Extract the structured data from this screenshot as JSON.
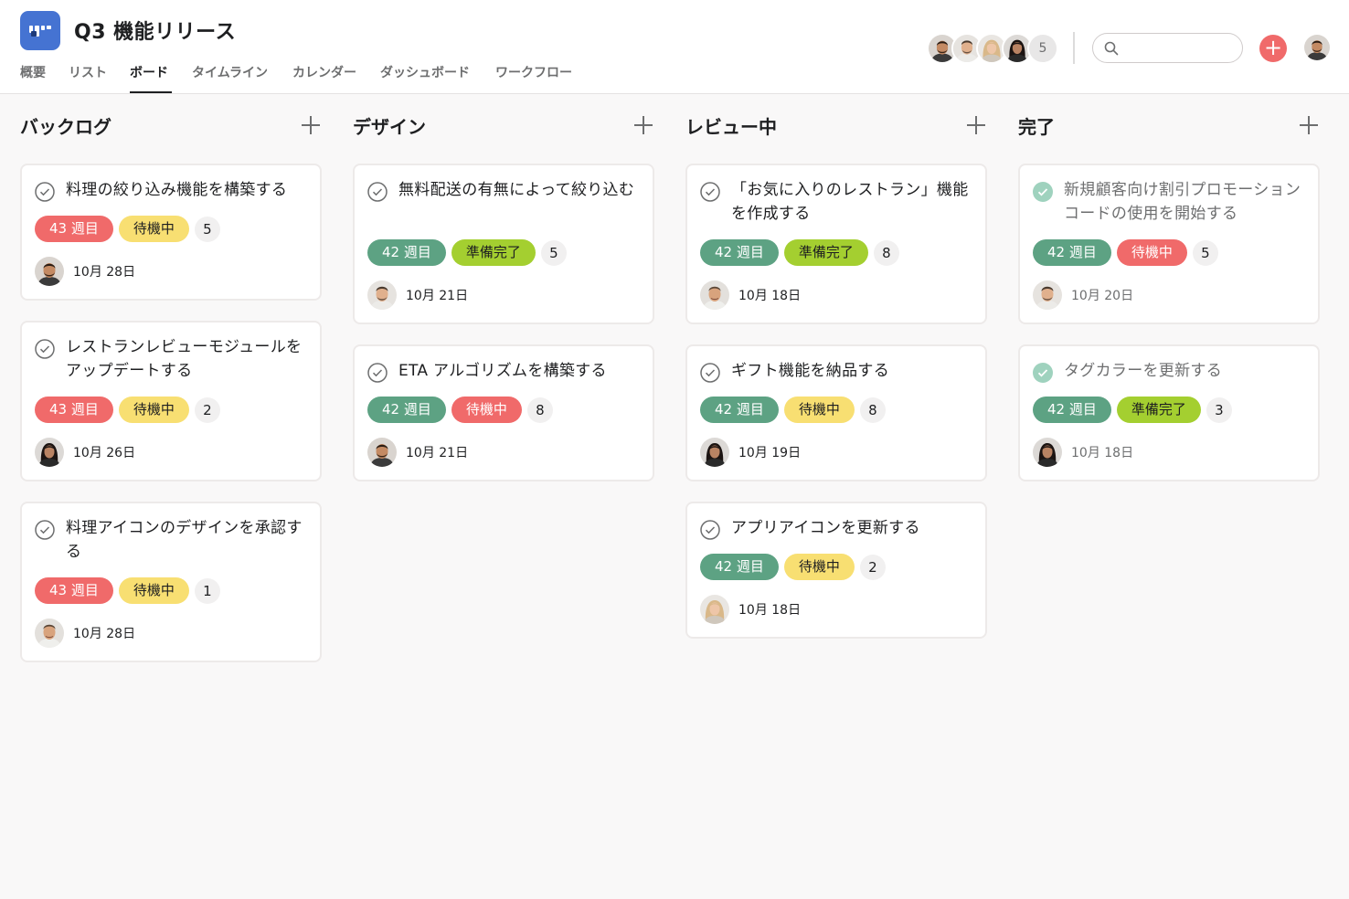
{
  "project": {
    "title": "Q3 機能リリース"
  },
  "tabs": [
    {
      "label": "概要"
    },
    {
      "label": "リスト"
    },
    {
      "label": "ボード"
    },
    {
      "label": "タイムライン"
    },
    {
      "label": "カレンダー"
    },
    {
      "label": "ダッシュボード"
    },
    {
      "label": "ワークフロー"
    }
  ],
  "active_tab": "ボード",
  "members": {
    "count": "5"
  },
  "search": {
    "placeholder": "",
    "value": ""
  },
  "colors": {
    "accent_red": "#f06a6a",
    "green": "#5da283",
    "yellow": "#f8df72",
    "lime": "#a4cf30"
  },
  "icons": [
    "search-icon",
    "plus-icon",
    "check-circle-icon",
    "app-board-icon"
  ],
  "columns": [
    {
      "title": "バックログ",
      "cards": [
        {
          "name": "料理の絞り込み機能を構築する",
          "week": "43 週目",
          "status": "待機中",
          "count": "5",
          "due": "10月 28日"
        },
        {
          "name": "レストランレビューモジュールをアップデートする",
          "week": "43 週目",
          "status": "待機中",
          "count": "2",
          "due": "10月 26日"
        },
        {
          "name": "料理アイコンのデザインを承認する",
          "week": "43 週目",
          "status": "待機中",
          "count": "1",
          "due": "10月 28日"
        }
      ]
    },
    {
      "title": "デザイン",
      "cards": [
        {
          "name": "無料配送の有無によって絞り込む",
          "week": "42 週目",
          "status": "準備完了",
          "count": "5",
          "due": "10月 21日"
        },
        {
          "name": "ETA アルゴリズムを構築する",
          "week": "42 週目",
          "status": "待機中",
          "count": "8",
          "due": "10月 21日"
        }
      ]
    },
    {
      "title": "レビュー中",
      "cards": [
        {
          "name": "「お気に入りのレストラン」機能を作成する",
          "week": "42 週目",
          "status": "準備完了",
          "count": "8",
          "due": "10月 18日"
        },
        {
          "name": "ギフト機能を納品する",
          "week": "42 週目",
          "status": "待機中",
          "count": "8",
          "due": "10月 19日"
        },
        {
          "name": "アプリアイコンを更新する",
          "week": "42 週目",
          "status": "待機中",
          "count": "2",
          "due": "10月 18日"
        }
      ]
    },
    {
      "title": "完了",
      "cards": [
        {
          "name": "新規顧客向け割引プロモーションコードの使用を開始する",
          "week": "42 週目",
          "status": "待機中",
          "count": "5",
          "due": "10月 20日"
        },
        {
          "name": "タグカラーを更新する",
          "week": "42 週目",
          "status": "準備完了",
          "count": "3",
          "due": "10月 18日"
        }
      ]
    }
  ]
}
